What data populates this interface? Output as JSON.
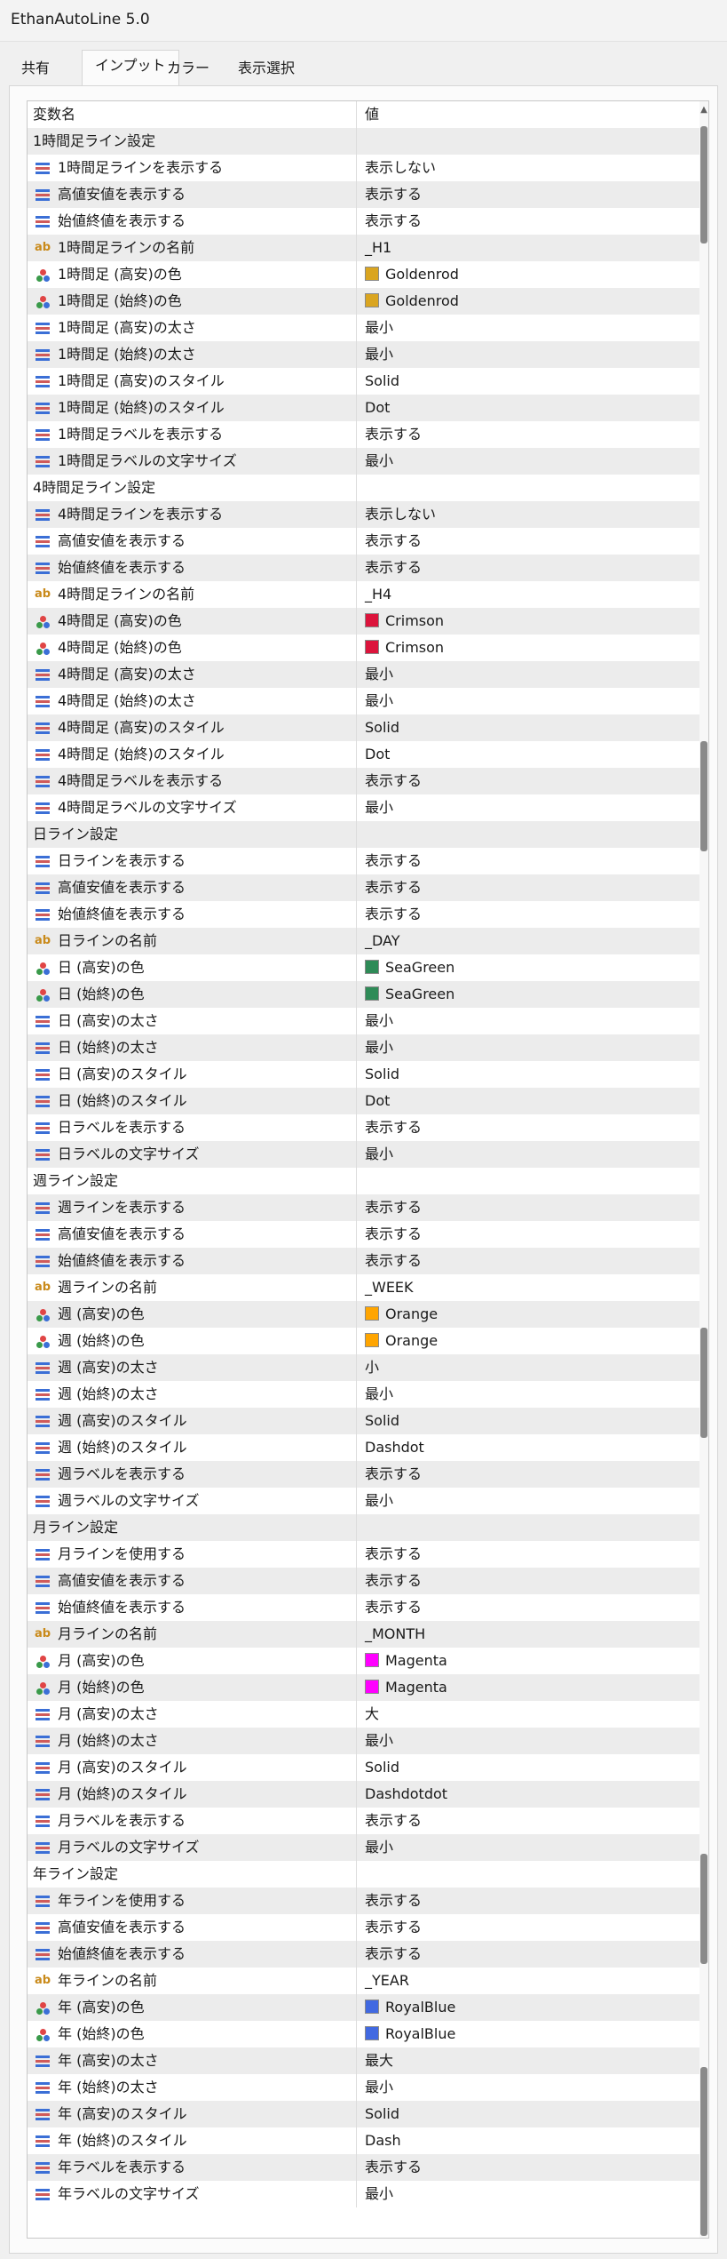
{
  "window": {
    "title": "EthanAutoLine 5.0"
  },
  "tabs": [
    {
      "label": "共有"
    },
    {
      "label": "インプット"
    },
    {
      "label": "カラー"
    },
    {
      "label": "表示選択"
    }
  ],
  "table": {
    "headers": [
      "変数名",
      "値"
    ],
    "rows": [
      {
        "kind": "header",
        "name": "変数名",
        "value": "値"
      },
      {
        "kind": "section",
        "name": "1時間足ライン設定",
        "value": ""
      },
      {
        "kind": "list",
        "name": "1時間足ラインを表示する",
        "value": "表示しない"
      },
      {
        "kind": "list",
        "name": "高値安値を表示する",
        "value": "表示する"
      },
      {
        "kind": "list",
        "name": "始値終値を表示する",
        "value": "表示する"
      },
      {
        "kind": "ab",
        "name": "1時間足ラインの名前",
        "value": "_H1"
      },
      {
        "kind": "color",
        "name": "1時間足 (高安)の色",
        "value": "Goldenrod",
        "swatch": "#daa520"
      },
      {
        "kind": "color",
        "name": "1時間足 (始終)の色",
        "value": "Goldenrod",
        "swatch": "#daa520"
      },
      {
        "kind": "list",
        "name": "1時間足 (高安)の太さ",
        "value": "最小"
      },
      {
        "kind": "list",
        "name": "1時間足 (始終)の太さ",
        "value": "最小"
      },
      {
        "kind": "list",
        "name": "1時間足 (高安)のスタイル",
        "value": "Solid"
      },
      {
        "kind": "list",
        "name": "1時間足 (始終)のスタイル",
        "value": "Dot"
      },
      {
        "kind": "list",
        "name": "1時間足ラベルを表示する",
        "value": "表示する"
      },
      {
        "kind": "list",
        "name": "1時間足ラベルの文字サイズ",
        "value": "最小"
      },
      {
        "kind": "section",
        "name": "4時間足ライン設定",
        "value": ""
      },
      {
        "kind": "list",
        "name": "4時間足ラインを表示する",
        "value": "表示しない"
      },
      {
        "kind": "list",
        "name": "高値安値を表示する",
        "value": "表示する"
      },
      {
        "kind": "list",
        "name": "始値終値を表示する",
        "value": "表示する"
      },
      {
        "kind": "ab",
        "name": "4時間足ラインの名前",
        "value": "_H4"
      },
      {
        "kind": "color",
        "name": "4時間足 (高安)の色",
        "value": "Crimson",
        "swatch": "#dc143c"
      },
      {
        "kind": "color",
        "name": "4時間足 (始終)の色",
        "value": "Crimson",
        "swatch": "#dc143c"
      },
      {
        "kind": "list",
        "name": "4時間足 (高安)の太さ",
        "value": "最小"
      },
      {
        "kind": "list",
        "name": "4時間足 (始終)の太さ",
        "value": "最小"
      },
      {
        "kind": "list",
        "name": "4時間足 (高安)のスタイル",
        "value": "Solid"
      },
      {
        "kind": "list",
        "name": "4時間足 (始終)のスタイル",
        "value": "Dot"
      },
      {
        "kind": "list",
        "name": "4時間足ラベルを表示する",
        "value": "表示する"
      },
      {
        "kind": "list",
        "name": "4時間足ラベルの文字サイズ",
        "value": "最小"
      },
      {
        "kind": "section",
        "name": "日ライン設定",
        "value": ""
      },
      {
        "kind": "list",
        "name": "日ラインを表示する",
        "value": "表示する"
      },
      {
        "kind": "list",
        "name": "高値安値を表示する",
        "value": "表示する"
      },
      {
        "kind": "list",
        "name": "始値終値を表示する",
        "value": "表示する"
      },
      {
        "kind": "ab",
        "name": "日ラインの名前",
        "value": "_DAY"
      },
      {
        "kind": "color",
        "name": "日 (高安)の色",
        "value": "SeaGreen",
        "swatch": "#2e8b57"
      },
      {
        "kind": "color",
        "name": "日 (始終)の色",
        "value": "SeaGreen",
        "swatch": "#2e8b57"
      },
      {
        "kind": "list",
        "name": "日 (高安)の太さ",
        "value": "最小"
      },
      {
        "kind": "list",
        "name": "日 (始終)の太さ",
        "value": "最小"
      },
      {
        "kind": "list",
        "name": "日 (高安)のスタイル",
        "value": "Solid"
      },
      {
        "kind": "list",
        "name": "日 (始終)のスタイル",
        "value": "Dot"
      },
      {
        "kind": "list",
        "name": "日ラベルを表示する",
        "value": "表示する"
      },
      {
        "kind": "list",
        "name": "日ラベルの文字サイズ",
        "value": "最小"
      },
      {
        "kind": "section",
        "name": "週ライン設定",
        "value": ""
      },
      {
        "kind": "list",
        "name": "週ラインを表示する",
        "value": "表示する"
      },
      {
        "kind": "list",
        "name": "高値安値を表示する",
        "value": "表示する"
      },
      {
        "kind": "list",
        "name": "始値終値を表示する",
        "value": "表示する"
      },
      {
        "kind": "ab",
        "name": "週ラインの名前",
        "value": "_WEEK"
      },
      {
        "kind": "color",
        "name": "週 (高安)の色",
        "value": "Orange",
        "swatch": "#ffa500"
      },
      {
        "kind": "color",
        "name": "週 (始終)の色",
        "value": "Orange",
        "swatch": "#ffa500"
      },
      {
        "kind": "list",
        "name": "週 (高安)の太さ",
        "value": "小"
      },
      {
        "kind": "list",
        "name": "週 (始終)の太さ",
        "value": "最小"
      },
      {
        "kind": "list",
        "name": "週 (高安)のスタイル",
        "value": "Solid"
      },
      {
        "kind": "list",
        "name": "週 (始終)のスタイル",
        "value": "Dashdot"
      },
      {
        "kind": "list",
        "name": "週ラベルを表示する",
        "value": "表示する"
      },
      {
        "kind": "list",
        "name": "週ラベルの文字サイズ",
        "value": "最小"
      },
      {
        "kind": "section",
        "name": "月ライン設定",
        "value": ""
      },
      {
        "kind": "list",
        "name": "月ラインを使用する",
        "value": "表示する"
      },
      {
        "kind": "list",
        "name": "高値安値を表示する",
        "value": "表示する"
      },
      {
        "kind": "list",
        "name": "始値終値を表示する",
        "value": "表示する"
      },
      {
        "kind": "ab",
        "name": "月ラインの名前",
        "value": "_MONTH"
      },
      {
        "kind": "color",
        "name": "月 (高安)の色",
        "value": "Magenta",
        "swatch": "#ff00ff"
      },
      {
        "kind": "color",
        "name": "月 (始終)の色",
        "value": "Magenta",
        "swatch": "#ff00ff"
      },
      {
        "kind": "list",
        "name": "月 (高安)の太さ",
        "value": "大"
      },
      {
        "kind": "list",
        "name": "月 (始終)の太さ",
        "value": "最小"
      },
      {
        "kind": "list",
        "name": "月 (高安)のスタイル",
        "value": "Solid"
      },
      {
        "kind": "list",
        "name": "月 (始終)のスタイル",
        "value": "Dashdotdot"
      },
      {
        "kind": "list",
        "name": "月ラベルを表示する",
        "value": "表示する"
      },
      {
        "kind": "list",
        "name": "月ラベルの文字サイズ",
        "value": "最小"
      },
      {
        "kind": "section",
        "name": "年ライン設定",
        "value": ""
      },
      {
        "kind": "list",
        "name": "年ラインを使用する",
        "value": "表示する"
      },
      {
        "kind": "list",
        "name": "高値安値を表示する",
        "value": "表示する"
      },
      {
        "kind": "list",
        "name": "始値終値を表示する",
        "value": "表示する"
      },
      {
        "kind": "ab",
        "name": "年ラインの名前",
        "value": "_YEAR"
      },
      {
        "kind": "color",
        "name": "年 (高安)の色",
        "value": "RoyalBlue",
        "swatch": "#4169e1"
      },
      {
        "kind": "color",
        "name": "年 (始終)の色",
        "value": "RoyalBlue",
        "swatch": "#4169e1"
      },
      {
        "kind": "list",
        "name": "年 (高安)の太さ",
        "value": "最大"
      },
      {
        "kind": "list",
        "name": "年 (始終)の太さ",
        "value": "最小"
      },
      {
        "kind": "list",
        "name": "年 (高安)のスタイル",
        "value": "Solid"
      },
      {
        "kind": "list",
        "name": "年 (始終)のスタイル",
        "value": "Dash"
      },
      {
        "kind": "list",
        "name": "年ラベルを表示する",
        "value": "表示する"
      },
      {
        "kind": "list",
        "name": "年ラベルの文字サイズ",
        "value": "最小"
      }
    ]
  },
  "icons": {
    "list": "list-param-icon",
    "ab": "string-param-icon",
    "color": "color-param-icon"
  },
  "colors": {
    "list_icon_blue": "#3b6fd6",
    "list_icon_red": "#d05a5a",
    "string_icon": "#c98a1a",
    "row_alt_bg": "#ececec",
    "scrollbar_thumb": "#8a8a8a"
  }
}
